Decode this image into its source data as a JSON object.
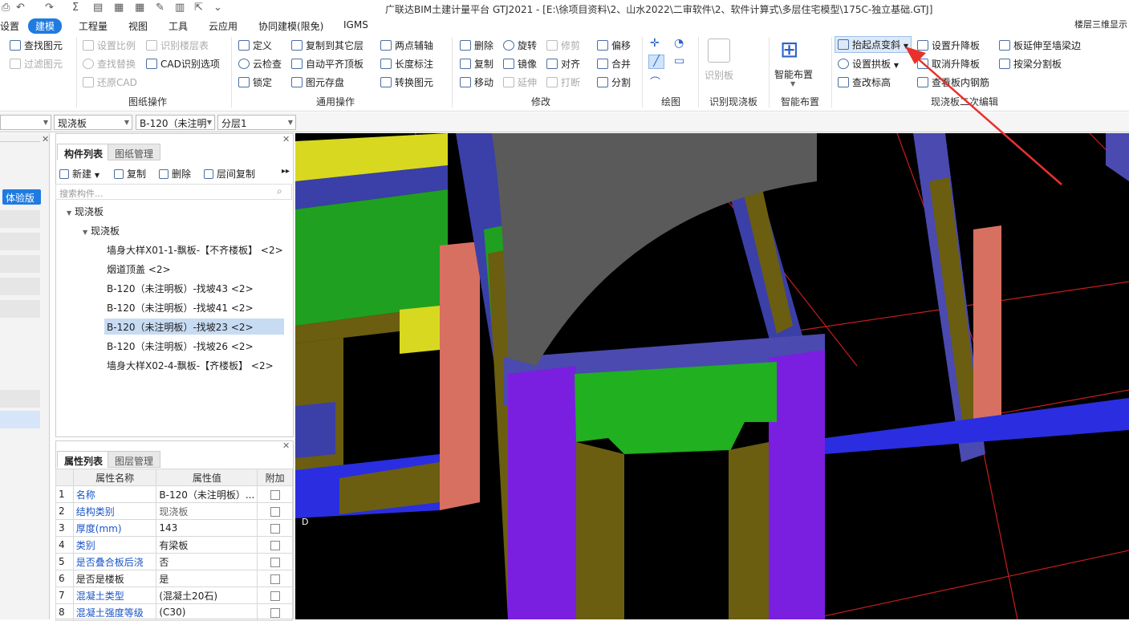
{
  "app_title": "广联达BIM土建计量平台 GTJ2021 - [E:\\徐项目资料\\2、山水2022\\二审软件\\2、软件计算式\\多层住宅模型\\175C-独立基础.GTJ]",
  "menu": [
    "设置",
    "建模",
    "工程量",
    "视图",
    "工具",
    "云应用",
    "协同建模(限免)",
    "IGMS"
  ],
  "floor_display": "楼层三维显示",
  "ribbon": {
    "drawing_ops": {
      "find_elem": "查找图元",
      "set_scale": "设置比例",
      "identify_floor": "识别楼层表",
      "filter_elem": "过滤图元",
      "find_replace": "查找替换",
      "cad_options": "CAD识别选项",
      "restore_cad": "还原CAD",
      "group": "图纸操作"
    },
    "general_ops": {
      "define": "定义",
      "copy_to_floor": "复制到其它层",
      "two_point_axis": "两点辅轴",
      "cloud_check": "云检查",
      "auto_flush_top": "自动平齐顶板",
      "length_mark": "长度标注",
      "lock": "锁定",
      "elem_save": "图元存盘",
      "convert_elem": "转换图元",
      "group": "通用操作"
    },
    "modify": {
      "delete": "删除",
      "rotate": "旋转",
      "trim": "修剪",
      "offset": "偏移",
      "copy": "复制",
      "mirror": "镜像",
      "align": "对齐",
      "merge": "合并",
      "move": "移动",
      "extend": "延伸",
      "break": "打断",
      "split": "分割",
      "group": "修改"
    },
    "draw": {
      "group": "绘图"
    },
    "identify_slab": {
      "label": "识别板",
      "group": "识别现浇板"
    },
    "smart_place": {
      "label": "智能布置",
      "group": "智能布置"
    },
    "slab_edit": {
      "raise_point": "抬起点变斜",
      "set_lift": "设置升降板",
      "extend_to_beam": "板延伸至墙梁边",
      "set_arch": "设置拱板",
      "cancel_lift": "取消升降板",
      "split_by_beam": "按梁分割板",
      "check_elev": "查改标高",
      "view_rebar": "查看板内钢筋",
      "group": "现浇板二次编辑"
    }
  },
  "filters": {
    "f1": "现浇板",
    "f2": "B-120（未注明",
    "f3": "分层1"
  },
  "left": {
    "trial": "体验版"
  },
  "components": {
    "tab_list": "构件列表",
    "tab_drawing": "图纸管理",
    "btn_new": "新建",
    "btn_copy": "复制",
    "btn_delete": "删除",
    "btn_floor_copy": "层间复制",
    "search_placeholder": "搜索构件...",
    "root": "现浇板",
    "child": "现浇板",
    "items": [
      "墙身大样X01-1-飘板-【不齐楼板】 <2>",
      "烟道顶盖 <2>",
      "B-120（未注明板）-找坡43 <2>",
      "B-120（未注明板）-找坡41 <2>",
      "B-120（未注明板）-找坡23 <2>",
      "B-120（未注明板）-找坡26 <2>",
      "墙身大样X02-4-飘板-【齐楼板】 <2>"
    ]
  },
  "properties": {
    "tab_props": "属性列表",
    "tab_layers": "图层管理",
    "headers": [
      "属性名称",
      "属性值",
      "附加"
    ],
    "rows": [
      {
        "n": "1",
        "name": "名称",
        "value": "B-120（未注明板）..."
      },
      {
        "n": "2",
        "name": "结构类别",
        "value": "现浇板"
      },
      {
        "n": "3",
        "name": "厚度(mm)",
        "value": "143"
      },
      {
        "n": "4",
        "name": "类别",
        "value": "有梁板"
      },
      {
        "n": "5",
        "name": "是否叠合板后浇",
        "value": "否"
      },
      {
        "n": "6",
        "name": "是否是楼板",
        "value": "是"
      },
      {
        "n": "7",
        "name": "混凝土类型",
        "value": "(混凝土20石)"
      },
      {
        "n": "8",
        "name": "混凝土强度等级",
        "value": "(C30)"
      }
    ]
  },
  "colors": {
    "accent": "#1f7be0",
    "selection": "#c7dbf3",
    "arrow": "#e8312b"
  }
}
